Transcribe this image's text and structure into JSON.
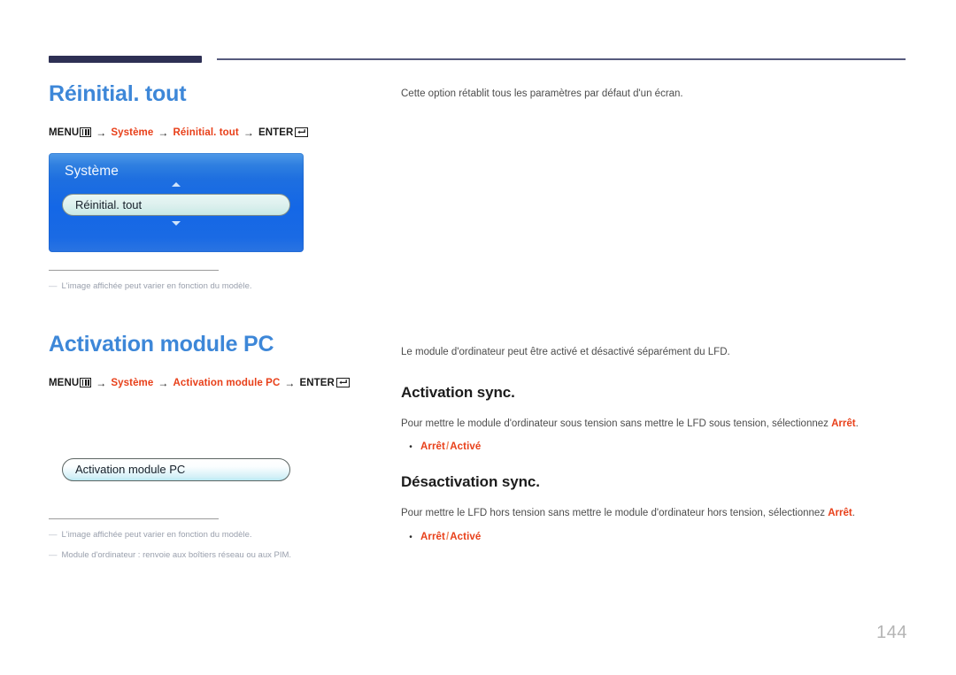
{
  "page": {
    "number": "144",
    "accent_blue": "#3d87d8",
    "accent_red": "#e8401a",
    "rule_navy": "#2e3054"
  },
  "sections": [
    {
      "title": "Réinitial. tout",
      "menu_path": {
        "menu_label": "MENU",
        "arrow": "→",
        "crumb1": "Système",
        "crumb2": "Réinitial. tout",
        "enter_label": "ENTER"
      },
      "osd": {
        "title": "Système",
        "item": "Réinitial. tout",
        "scroll_up": "scroll-up",
        "scroll_down": "scroll-down"
      },
      "notes": [
        "L'image affichée peut varier en fonction du modèle."
      ],
      "body": {
        "intro": "Cette option rétablit tous les paramètres par défaut d'un écran."
      }
    },
    {
      "title": "Activation module PC",
      "menu_path": {
        "menu_label": "MENU",
        "arrow": "→",
        "crumb1": "Système",
        "crumb2": "Activation module PC",
        "enter_label": "ENTER"
      },
      "osd": {
        "item": "Activation module PC"
      },
      "notes": [
        "L'image affichée peut varier en fonction du modèle.",
        "Module d'ordinateur : renvoie aux boîtiers réseau ou aux PIM."
      ],
      "body": {
        "intro": "Le module d'ordinateur peut être activé et désactivé séparément du LFD.",
        "subsections": [
          {
            "heading": "Activation sync.",
            "paragraph_pre": "Pour mettre le module d'ordinateur sous tension sans mettre le LFD sous tension, sélectionnez ",
            "paragraph_hl": "Arrêt",
            "paragraph_post": ".",
            "bullet_dot": "•",
            "option_off": "Arrêt",
            "option_sep": "/",
            "option_on": "Activé"
          },
          {
            "heading": "Désactivation sync.",
            "paragraph_pre": "Pour mettre le LFD hors tension sans mettre le module d'ordinateur hors tension, sélectionnez ",
            "paragraph_hl": "Arrêt",
            "paragraph_post": ".",
            "bullet_dot": "•",
            "option_off": "Arrêt",
            "option_sep": "/",
            "option_on": "Activé"
          }
        ]
      }
    }
  ]
}
